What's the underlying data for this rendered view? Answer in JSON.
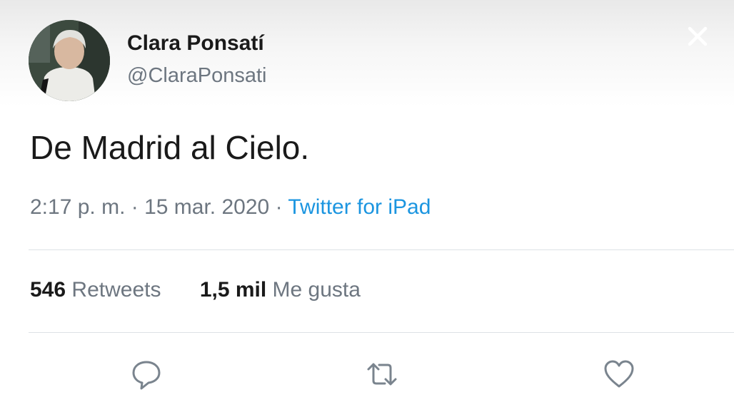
{
  "user": {
    "display_name": "Clara Ponsatí",
    "handle": "@ClaraPonsati",
    "avatar": "user-avatar-photo"
  },
  "tweet": {
    "text": "De Madrid al Cielo.",
    "time": "2:17 p. m.",
    "separator": "·",
    "date": "15 mar. 2020",
    "source": "Twitter for iPad"
  },
  "stats": {
    "retweets_count": "546",
    "retweets_label": "Retweets",
    "likes_count": "1,5 mil",
    "likes_label": "Me gusta"
  },
  "icons": {
    "close": "close-icon",
    "reply": "reply-icon",
    "retweet": "retweet-icon",
    "like": "heart-icon"
  },
  "colors": {
    "link": "#1b95e0",
    "muted": "#6d7680",
    "text": "#1a1a1a",
    "divider": "#dde2e6"
  }
}
